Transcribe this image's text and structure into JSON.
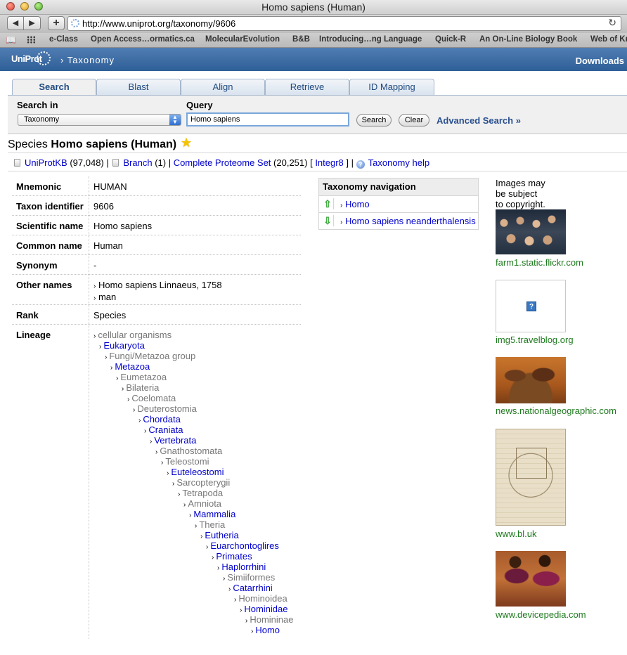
{
  "window": {
    "title": "Homo sapiens (Human)",
    "url": "http://www.uniprot.org/taxonomy/9606",
    "add_label": "+",
    "back_label": "◀",
    "forward_label": "▶",
    "reload_label": "↻"
  },
  "bookmarks": [
    "e-Class",
    "Open Access…ormatics.ca",
    "MolecularEvolution",
    "B&B",
    "Introducing…ng Language",
    "Quick-R",
    "An On-Line Biology Book",
    "Web of Kn"
  ],
  "header": {
    "logo": "UniProt",
    "section": "› Taxonomy",
    "downloads": "Downloads"
  },
  "tabs": [
    {
      "label": "Search",
      "active": true
    },
    {
      "label": "Blast"
    },
    {
      "label": "Align"
    },
    {
      "label": "Retrieve"
    },
    {
      "label": "ID Mapping"
    }
  ],
  "search": {
    "search_in_label": "Search in",
    "database": "Taxonomy",
    "query_label": "Query",
    "query_value": "Homo sapiens",
    "search_button": "Search",
    "clear_button": "Clear",
    "advanced": "Advanced Search »"
  },
  "species": {
    "prefix": "Species",
    "name": "Homo sapiens (Human)"
  },
  "links": {
    "uniprotkb": "UniProtKB",
    "uniprotkb_count": "(97,048)",
    "branch": "Branch",
    "branch_count": "(1)",
    "proteome": "Complete Proteome Set",
    "proteome_count": "(20,251)",
    "integr8": "Integr8",
    "help": "Taxonomy help"
  },
  "info": {
    "mnemonic_label": "Mnemonic",
    "mnemonic": "HUMAN",
    "taxon_label": "Taxon identifier",
    "taxon": "9606",
    "scientific_label": "Scientific name",
    "scientific": "Homo sapiens",
    "common_label": "Common name",
    "common": "Human",
    "synonym_label": "Synonym",
    "synonym": "-",
    "other_label": "Other names",
    "other_1": "Homo sapiens Linnaeus, 1758",
    "other_2": "man",
    "rank_label": "Rank",
    "rank": "Species",
    "lineage_label": "Lineage"
  },
  "lineage": [
    {
      "name": "cellular organisms",
      "link": false
    },
    {
      "name": "Eukaryota",
      "link": true
    },
    {
      "name": "Fungi/Metazoa group",
      "link": false
    },
    {
      "name": "Metazoa",
      "link": true
    },
    {
      "name": "Eumetazoa",
      "link": false
    },
    {
      "name": "Bilateria",
      "link": false
    },
    {
      "name": "Coelomata",
      "link": false
    },
    {
      "name": "Deuterostomia",
      "link": false
    },
    {
      "name": "Chordata",
      "link": true
    },
    {
      "name": "Craniata",
      "link": true
    },
    {
      "name": "Vertebrata",
      "link": true
    },
    {
      "name": "Gnathostomata",
      "link": false
    },
    {
      "name": "Teleostomi",
      "link": false
    },
    {
      "name": "Euteleostomi",
      "link": true
    },
    {
      "name": "Sarcopterygii",
      "link": false
    },
    {
      "name": "Tetrapoda",
      "link": false
    },
    {
      "name": "Amniota",
      "link": false
    },
    {
      "name": "Mammalia",
      "link": true
    },
    {
      "name": "Theria",
      "link": false
    },
    {
      "name": "Eutheria",
      "link": true
    },
    {
      "name": "Euarchontoglires",
      "link": true
    },
    {
      "name": "Primates",
      "link": true
    },
    {
      "name": "Haplorrhini",
      "link": true
    },
    {
      "name": "Simiiformes",
      "link": false
    },
    {
      "name": "Catarrhini",
      "link": true
    },
    {
      "name": "Hominoidea",
      "link": false
    },
    {
      "name": "Hominidae",
      "link": true
    },
    {
      "name": "Homininae",
      "link": false
    },
    {
      "name": "Homo",
      "link": true
    }
  ],
  "taxnav": {
    "title": "Taxonomy navigation",
    "up": "Homo",
    "down": "Homo sapiens neanderthalensis"
  },
  "images": {
    "note_1": "Images may",
    "note_2": "be subject",
    "note_3": "to copyright.",
    "sources": [
      "farm1.static.flickr.com",
      "img5.travelblog.org",
      "news.nationalgeographic.com",
      "www.bl.uk",
      "www.devicepedia.com"
    ]
  }
}
